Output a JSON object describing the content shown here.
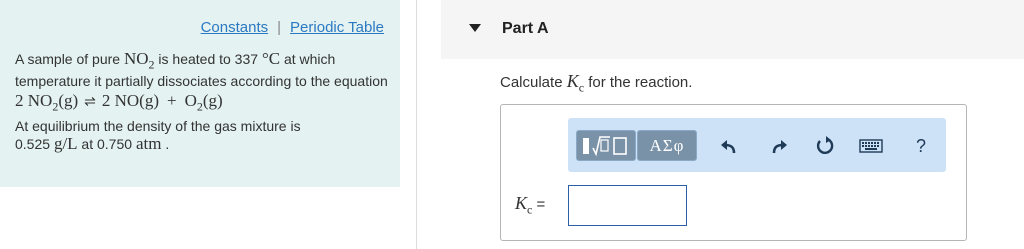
{
  "links": {
    "constants": "Constants",
    "separator": "|",
    "periodic_table": "Periodic Table"
  },
  "problem": {
    "intro_a": "A sample of pure ",
    "compound": "NO",
    "compound_sub": "2",
    "intro_b": " is heated to 337 ",
    "temp_unit": "°C",
    "intro_c": " at which temperature it partially dissociates according to the equation",
    "eq_lhs_coef": "2 NO",
    "eq_lhs_sub": "2",
    "eq_lhs_state": "(g)",
    "eq_arrow": "⇌",
    "eq_rhs_1": "2 NO(g)",
    "eq_plus": "+",
    "eq_rhs_2": "O",
    "eq_rhs_2_sub": "2",
    "eq_rhs_2_state": "(g)",
    "equil_a": "At equilibrium the density of the gas mixture is",
    "density_value": "0.525 ",
    "density_unit": "g/L",
    "equil_b": " at 0.750 ",
    "pressure_unit": "atm",
    "equil_c": " ."
  },
  "part": {
    "title": "Part A"
  },
  "question": {
    "pre": "Calculate ",
    "var": "K",
    "var_sub": "c",
    "post": " for the reaction."
  },
  "toolbar": {
    "templates_icon": "templates-icon",
    "symbols_label": "ΑΣφ",
    "undo_icon": "undo-icon",
    "redo_icon": "redo-icon",
    "reset_icon": "reset-icon",
    "keyboard_icon": "keyboard-icon",
    "help_label": "?"
  },
  "answer": {
    "label_var": "K",
    "label_sub": "c",
    "label_eq": " =",
    "value": ""
  }
}
